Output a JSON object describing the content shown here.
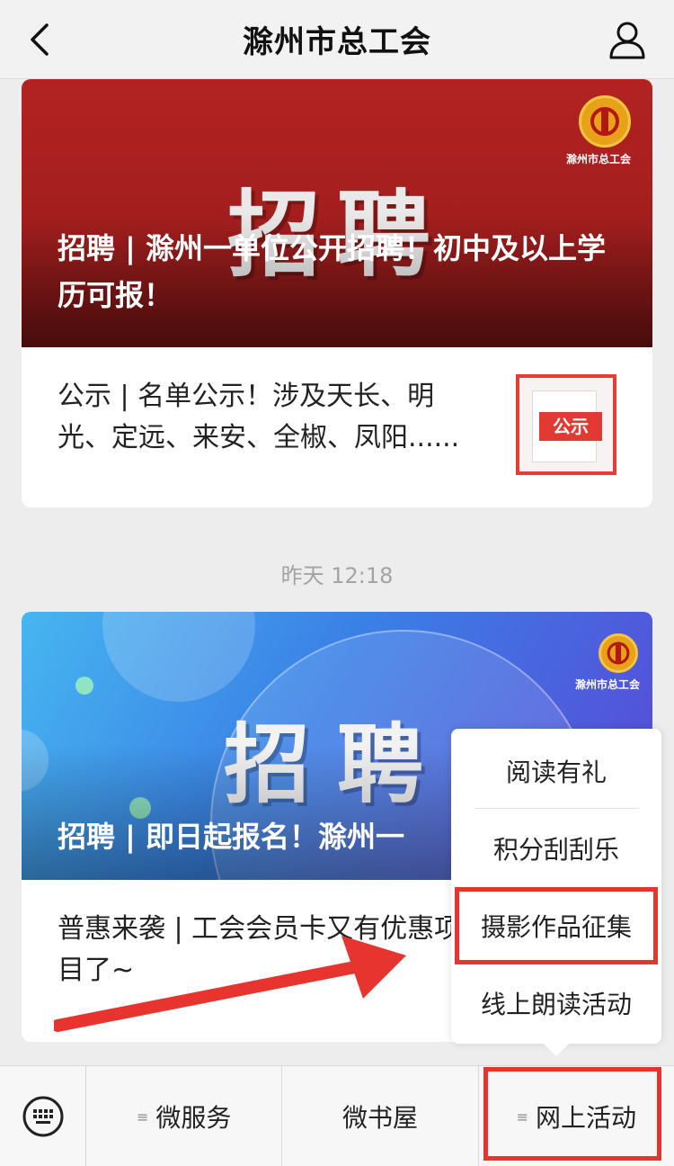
{
  "header": {
    "title": "滁州市总工会",
    "back_icon": "chevron-left-icon",
    "user_icon": "user-icon"
  },
  "card1": {
    "hero_big_text": "招聘",
    "headline": "招聘 | 滁州一单位公开招聘！初中及以上学历可报！",
    "logo_name": "滁州市总工会",
    "row_text": "公示 | 名单公示！涉及天长、明光、定远、来安、全椒、凤阳......",
    "thumb_tag": "公示"
  },
  "timestamp": "昨天 12:18",
  "card2": {
    "hero_big_text": "招聘",
    "headline": "招聘 | 即日起报名！滁州一",
    "logo_name": "滁州市总工会",
    "row_text": "普惠来袭 | 工会会员卡又有优惠项目了~"
  },
  "popup_menu": {
    "items": [
      "阅读有礼",
      "积分刮刮乐",
      "摄影作品征集",
      "线上朗读活动"
    ],
    "highlighted_index": 2
  },
  "bottom_bar": {
    "keyboard_icon": "keyboard-icon",
    "tabs": [
      "微服务",
      "微书屋",
      "网上活动"
    ],
    "menu_marker": "≡"
  },
  "colors": {
    "accent_red": "#e8342f",
    "hero_red": "#a31e1e",
    "hero_blue": "#3a7fe6",
    "logo_gold": "#e8a21a"
  }
}
